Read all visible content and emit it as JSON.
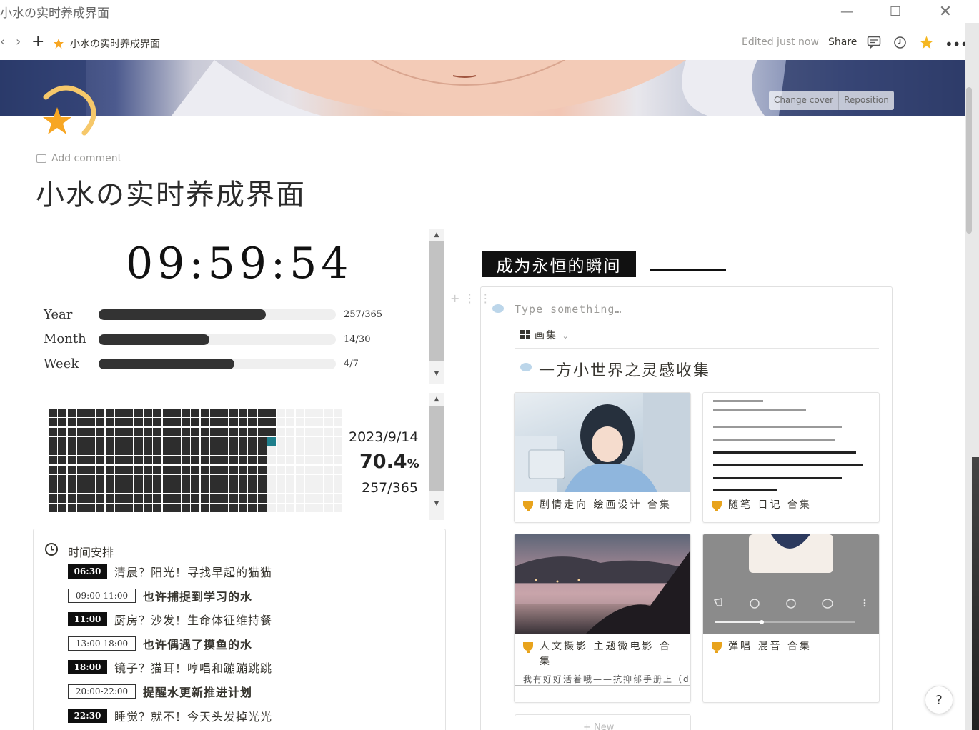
{
  "window": {
    "title": "小水の实时养成界面"
  },
  "topbar": {
    "breadcrumb": "小水の实时养成界面",
    "edited": "Edited just now",
    "share": "Share"
  },
  "cover": {
    "change_cover": "Change cover",
    "reposition": "Reposition"
  },
  "page": {
    "add_comment": "Add comment",
    "title": "小水の实时养成界面"
  },
  "clock": {
    "time": "09:59:54"
  },
  "progress": [
    {
      "label": "Year",
      "value": "257/365",
      "fraction": 0.704
    },
    {
      "label": "Month",
      "value": "14/30",
      "fraction": 0.467
    },
    {
      "label": "Week",
      "value": "4/7",
      "fraction": 0.571
    }
  ],
  "year_grid": {
    "date": "2023/9/14",
    "percent": "70.4",
    "percent_sign": "%",
    "count": "257/365",
    "days_done": 257,
    "total_days": 365
  },
  "schedule": {
    "title": "时间安排",
    "items": [
      {
        "time": "06:30",
        "text": "清晨？阳光！寻找早起的猫猫",
        "style": "fill"
      },
      {
        "time": "09:00-11:00",
        "text": "也许捕捉到学习的水",
        "style": "out"
      },
      {
        "time": "11:00",
        "text": "厨房？沙发！生命体征维持餐",
        "style": "fill"
      },
      {
        "time": "13:00-18:00",
        "text": "也许偶遇了摸鱼的水",
        "style": "out"
      },
      {
        "time": "18:00",
        "text": "镜子？猫耳！哼唱和蹦蹦跳跳",
        "style": "fill"
      },
      {
        "time": "20:00-22:00",
        "text": "提醒水更新推进计划",
        "style": "out"
      },
      {
        "time": "22:30",
        "text": "睡觉？就不！今天头发掉光光",
        "style": "fill"
      }
    ]
  },
  "moments": {
    "banner": "成为永恒的瞬间",
    "placeholder": "Type something…",
    "view_label": "画集",
    "gallery_title": "一方小世界之灵感收集",
    "cards": [
      {
        "caption": "剧情走向 绘画设计 合集",
        "sub": ""
      },
      {
        "caption": "随笔 日记 合集",
        "sub": ""
      },
      {
        "caption": "人文摄影 主题微电影 合集",
        "sub": "我有好好活着哦——抗抑郁手册上（d"
      },
      {
        "caption": "弹唱 混音 合集",
        "sub": ""
      }
    ],
    "new_label": "+ New"
  },
  "help": "?"
}
